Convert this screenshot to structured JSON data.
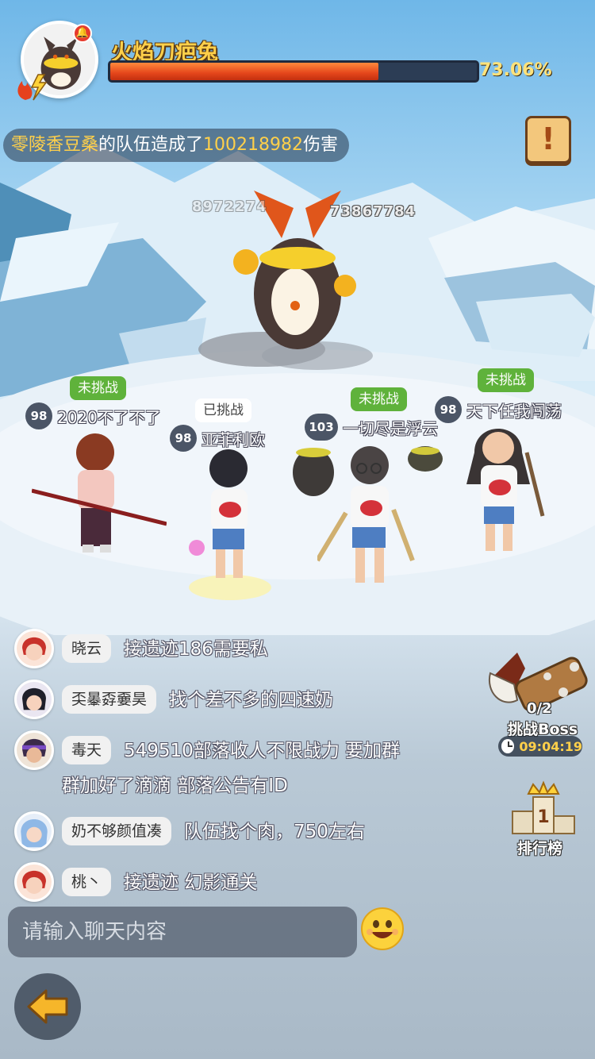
{
  "boss": {
    "name": "火焰刀疤兔",
    "hp_percent_text": "73.06%",
    "hp_fraction": 0.7306,
    "alert_icon": "bell-icon",
    "element_icon": "fire-lightning-icon"
  },
  "damage_banner": {
    "team": "零陵香豆桑",
    "middle": "的队伍造成了",
    "damage": "100218982",
    "suffix": "伤害"
  },
  "floating_damage": [
    "8972274",
    "73867784"
  ],
  "players": [
    {
      "status": "未挑战",
      "level": "98",
      "name": "2020不了不了"
    },
    {
      "status": "已挑战",
      "level": "98",
      "name": "亚菲利欧"
    },
    {
      "status": "未挑战",
      "level": "103",
      "name": "一切尽是浮云"
    },
    {
      "status": "未挑战",
      "level": "98",
      "name": "天下任我闯荡"
    }
  ],
  "chat": [
    {
      "name": "晓云",
      "message": "接遗迹186需要私"
    },
    {
      "name": "奀曓孬嫑昊",
      "message": "找个差不多的四速奶"
    },
    {
      "name": "毒天",
      "message": "549510部落收人不限战力  要加群",
      "message2": "群加好了滴滴  部落公告有ID"
    },
    {
      "name": "奶不够颜值凑",
      "message": "队伍找个肉，750左右"
    },
    {
      "name": "桃丶",
      "message": "接遗迹 幻影通关"
    }
  ],
  "chat_input": {
    "placeholder": "请输入聊天内容"
  },
  "challenge": {
    "count": "0/2",
    "label": "挑战Boss",
    "timer": "09:04:19"
  },
  "ranking": {
    "label": "排行榜",
    "rank_digit": "1"
  },
  "colors": {
    "accent_gold": "#ffd04a",
    "hp_red": "#e4461b",
    "status_green": "#5fb23b"
  }
}
